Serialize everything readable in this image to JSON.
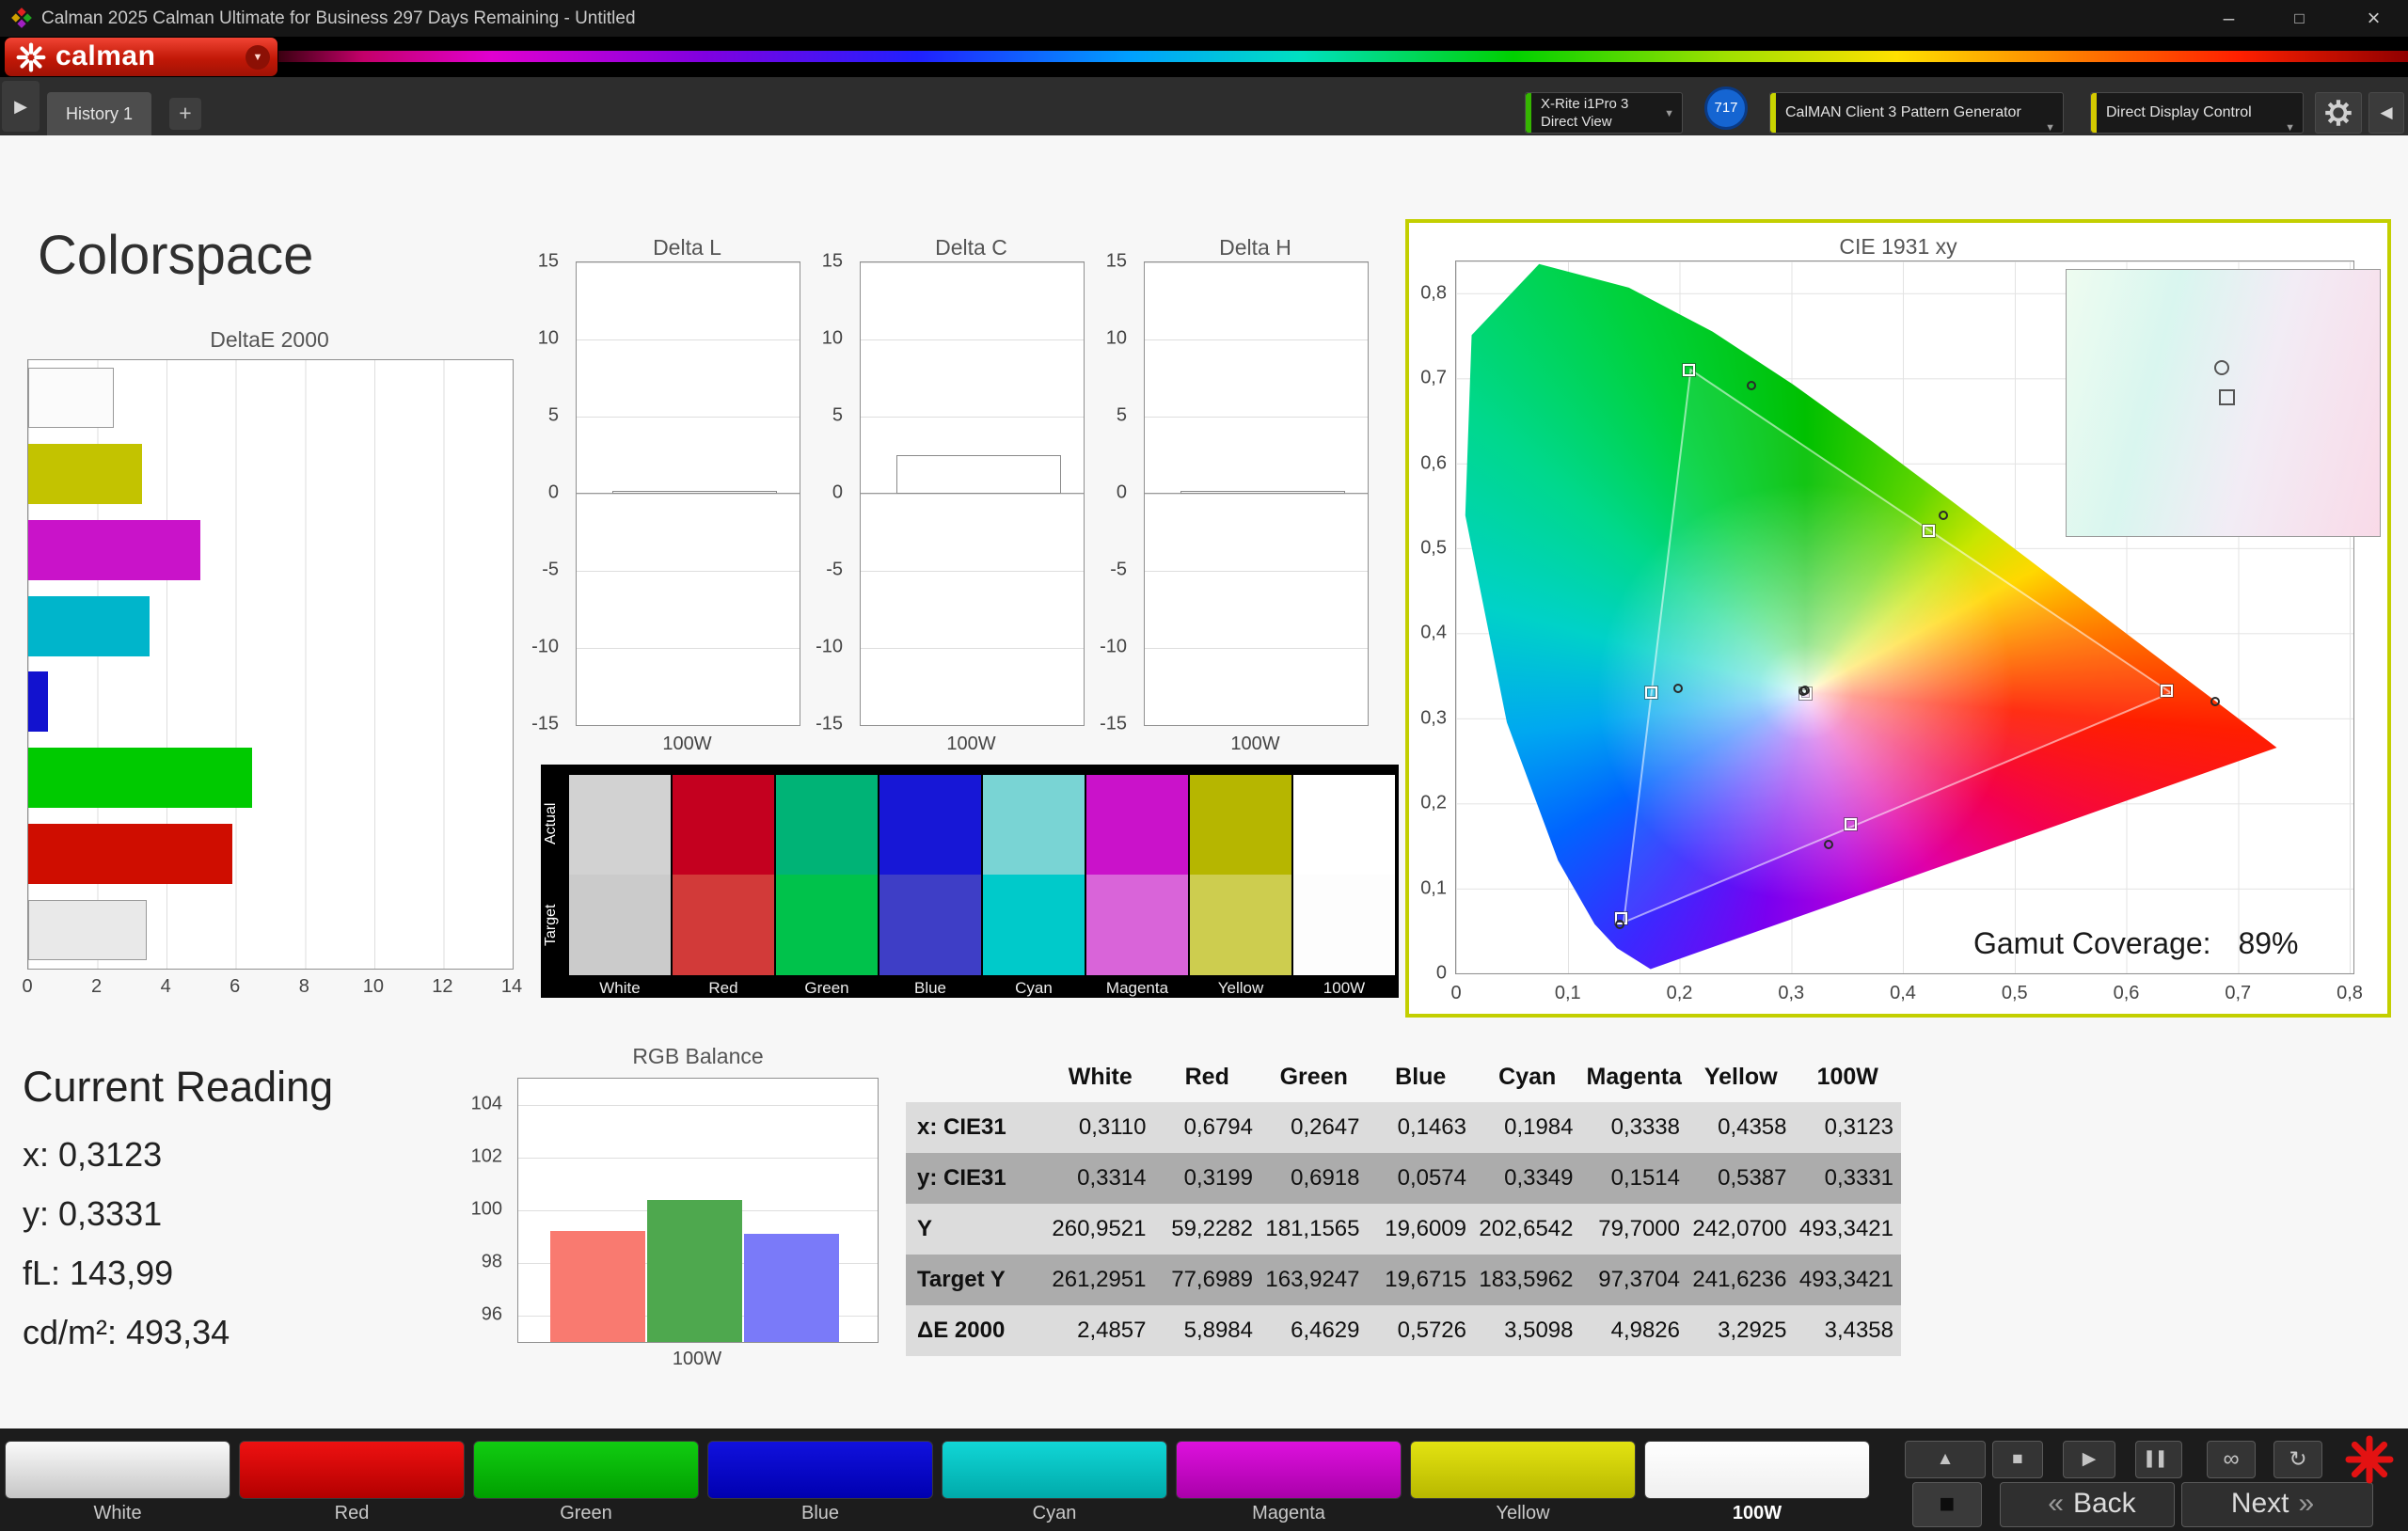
{
  "titlebar": {
    "title": "Calman 2025 Calman Ultimate for Business 297 Days Remaining - Untitled",
    "minimize": "–",
    "maximize": "□",
    "close": "×"
  },
  "brand": {
    "logo_text": "calman",
    "caret": "▼"
  },
  "toolbar": {
    "expander": "▶",
    "history_tab": "History 1",
    "add_tab": "+",
    "dropdown_arrow": "▼",
    "meter_line1": "X-Rite i1Pro 3",
    "meter_line2": "Direct View",
    "meter_badge": "717",
    "pattern_generator": "CalMAN Client 3 Pattern Generator",
    "display_control": "Direct Display Control",
    "collapse": "◀"
  },
  "page": {
    "title": "Colorspace"
  },
  "deltae_chart": {
    "title": "DeltaE 2000",
    "xmax": 14,
    "xticks": [
      0,
      2,
      4,
      6,
      8,
      10,
      12,
      14
    ],
    "bars": [
      {
        "name": "White",
        "value": 2.4857,
        "color": "#fbfbfb"
      },
      {
        "name": "Yellow",
        "value": 3.2925,
        "color": "#c3c300"
      },
      {
        "name": "Magenta",
        "value": 4.9826,
        "color": "#c913c9"
      },
      {
        "name": "Cyan",
        "value": 3.5098,
        "color": "#00b5cb"
      },
      {
        "name": "Blue",
        "value": 0.5726,
        "color": "#1212cf"
      },
      {
        "name": "Green",
        "value": 6.4629,
        "color": "#00ca00"
      },
      {
        "name": "Red",
        "value": 5.8984,
        "color": "#cf0d00"
      },
      {
        "name": "100W",
        "value": 3.4358,
        "color": "#e9e9e9"
      }
    ]
  },
  "delta_axis": {
    "min": -15,
    "max": 15,
    "ticks": [
      15,
      10,
      5,
      0,
      -5,
      -10,
      -15
    ]
  },
  "delta_charts": [
    {
      "title": "Delta L",
      "value": 0.0,
      "xlabel": "100W"
    },
    {
      "title": "Delta C",
      "value": 2.5,
      "xlabel": "100W"
    },
    {
      "title": "Delta H",
      "value": 0.0,
      "xlabel": "100W"
    }
  ],
  "swatches": {
    "row_labels": [
      "Actual",
      "Target"
    ],
    "items": [
      {
        "label": "White",
        "actual": "#d2d2d2",
        "target": "#cbcbcb"
      },
      {
        "label": "Red",
        "actual": "#c4001f",
        "target": "#d23a39"
      },
      {
        "label": "Green",
        "actual": "#00b376",
        "target": "#00c24b"
      },
      {
        "label": "Blue",
        "actual": "#1717d6",
        "target": "#3e3ec6"
      },
      {
        "label": "Cyan",
        "actual": "#79d4d4",
        "target": "#00caca"
      },
      {
        "label": "Magenta",
        "actual": "#ca12ca",
        "target": "#d964d9"
      },
      {
        "label": "Yellow",
        "actual": "#b6b600",
        "target": "#cdcd4f"
      },
      {
        "label": "100W",
        "actual": "#ffffff",
        "target": "#fdfdfd"
      }
    ]
  },
  "cie_chart": {
    "title": "CIE 1931 xy",
    "coverage_label": "Gamut Coverage:",
    "coverage_value": "89%",
    "xticks": [
      "0",
      "0,1",
      "0,2",
      "0,3",
      "0,4",
      "0,5",
      "0,6",
      "0,7",
      "0,8"
    ],
    "yticks": [
      "0",
      "0,1",
      "0,2",
      "0,3",
      "0,4",
      "0,5",
      "0,6",
      "0,7",
      "0,8"
    ],
    "triangle": [
      [
        0.64,
        0.33
      ],
      [
        0.21,
        0.71
      ],
      [
        0.15,
        0.06
      ]
    ],
    "targets": [
      [
        0.3127,
        0.329
      ],
      [
        0.636,
        0.332
      ],
      [
        0.208,
        0.71
      ],
      [
        0.148,
        0.065
      ],
      [
        0.175,
        0.33
      ],
      [
        0.353,
        0.175
      ],
      [
        0.423,
        0.52
      ]
    ],
    "measured": [
      [
        0.311,
        0.3314
      ],
      [
        0.6794,
        0.3199
      ],
      [
        0.2647,
        0.6918
      ],
      [
        0.1463,
        0.0574
      ],
      [
        0.1984,
        0.3349
      ],
      [
        0.3338,
        0.1514
      ],
      [
        0.4358,
        0.5387
      ],
      [
        0.3123,
        0.3331
      ]
    ]
  },
  "current_reading": {
    "title": "Current Reading",
    "lines": [
      {
        "label": "x:",
        "value": "0,3123"
      },
      {
        "label": "y:",
        "value": "0,3331"
      },
      {
        "label": "fL:",
        "value": "143,99"
      },
      {
        "label": "cd/m²:",
        "value": "493,34"
      }
    ]
  },
  "rgb_balance": {
    "title": "RGB Balance",
    "xlabel": "100W",
    "ymin": 95,
    "ymax": 105,
    "yticks": [
      104,
      102,
      100,
      98,
      96
    ],
    "bars": [
      {
        "name": "red",
        "value": 99.2,
        "color": "#f97a70"
      },
      {
        "name": "green",
        "value": 100.4,
        "color": "#4ea84e"
      },
      {
        "name": "blue",
        "value": 99.1,
        "color": "#7a7af9"
      }
    ]
  },
  "table": {
    "columns": [
      "White",
      "Red",
      "Green",
      "Blue",
      "Cyan",
      "Magenta",
      "Yellow",
      "100W"
    ],
    "rows": [
      {
        "label": "x: CIE31",
        "values": [
          "0,3110",
          "0,6794",
          "0,2647",
          "0,1463",
          "0,1984",
          "0,3338",
          "0,4358",
          "0,3123"
        ]
      },
      {
        "label": "y: CIE31",
        "values": [
          "0,3314",
          "0,3199",
          "0,6918",
          "0,0574",
          "0,3349",
          "0,1514",
          "0,5387",
          "0,3331"
        ]
      },
      {
        "label": "Y",
        "values": [
          "260,9521",
          "59,2282",
          "181,1565",
          "19,6009",
          "202,6542",
          "79,7000",
          "242,0700",
          "493,3421"
        ]
      },
      {
        "label": "Target Y",
        "values": [
          "261,2951",
          "77,6989",
          "163,9247",
          "19,6715",
          "183,5962",
          "97,3704",
          "241,6236",
          "493,3421"
        ]
      },
      {
        "label": "ΔE 2000",
        "values": [
          "2,4857",
          "5,8984",
          "6,4629",
          "0,5726",
          "3,5098",
          "4,9826",
          "3,2925",
          "3,4358"
        ]
      }
    ]
  },
  "bottombar": {
    "patterns": [
      {
        "label": "White",
        "color1": "#fafafa",
        "color2": "#c6c6c6"
      },
      {
        "label": "Red",
        "color1": "#ee1111",
        "color2": "#b30000"
      },
      {
        "label": "Green",
        "color1": "#11cc11",
        "color2": "#00a000"
      },
      {
        "label": "Blue",
        "color1": "#1111dd",
        "color2": "#0000b0"
      },
      {
        "label": "Cyan",
        "color1": "#11d6d6",
        "color2": "#00aaaa"
      },
      {
        "label": "Magenta",
        "color1": "#dd11dd",
        "color2": "#aa00aa"
      },
      {
        "label": "Yellow",
        "color1": "#e3e311",
        "color2": "#b8b800"
      },
      {
        "label": "100W",
        "color1": "#ffffff",
        "color2": "#efefef"
      }
    ],
    "controls": {
      "panel_up": "▲",
      "stop": "■",
      "play": "▶",
      "pause": "▌▌",
      "loop": "∞",
      "refresh": "↻",
      "pattern_window": "■"
    },
    "back_chevron": "«",
    "back_label": "Back",
    "next_label": "Next",
    "next_chevron": "»"
  }
}
